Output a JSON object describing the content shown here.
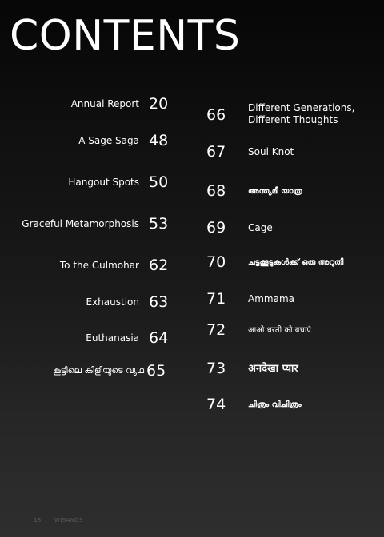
{
  "title": "CONTENTS",
  "left_entries": [
    {
      "text": "Annual Report",
      "page": "20"
    },
    {
      "text": "A Sage Saga",
      "page": "48"
    },
    {
      "text": "Hangout Spots",
      "page": "50"
    },
    {
      "text": "Graceful Metamorphosis",
      "page": "53"
    },
    {
      "text": "To the Gulmohar",
      "page": "62"
    },
    {
      "text": "Exhaustion",
      "page": "63"
    },
    {
      "text": "Euthanasia",
      "page": "64"
    },
    {
      "text": "കൂട്ടിലെ കിളിയുടെ വ്യഥ",
      "page": "65"
    }
  ],
  "right_entries": [
    {
      "page": "66",
      "line1": "Different Generations,",
      "line2": "Different Thoughts"
    },
    {
      "page": "67",
      "text": "Soul  Knot"
    },
    {
      "page": "68",
      "text": "അന്ത്യമീ യാത്ര"
    },
    {
      "page": "69",
      "text": "Cage"
    },
    {
      "page": "70",
      "text": "ചട്ടക്കൂടുകൾക്ക് ഒരു അറുതി"
    },
    {
      "page": "71",
      "text": "Ammama"
    },
    {
      "page": "72",
      "text": "आओ धरती को बचाएं"
    },
    {
      "page": "73",
      "text": "अनदेखा प्यार"
    },
    {
      "page": "74",
      "text": "ചിത്രം വിചിത്രം"
    }
  ],
  "footer": {
    "page_number": "18",
    "publication": "WISANOS"
  }
}
